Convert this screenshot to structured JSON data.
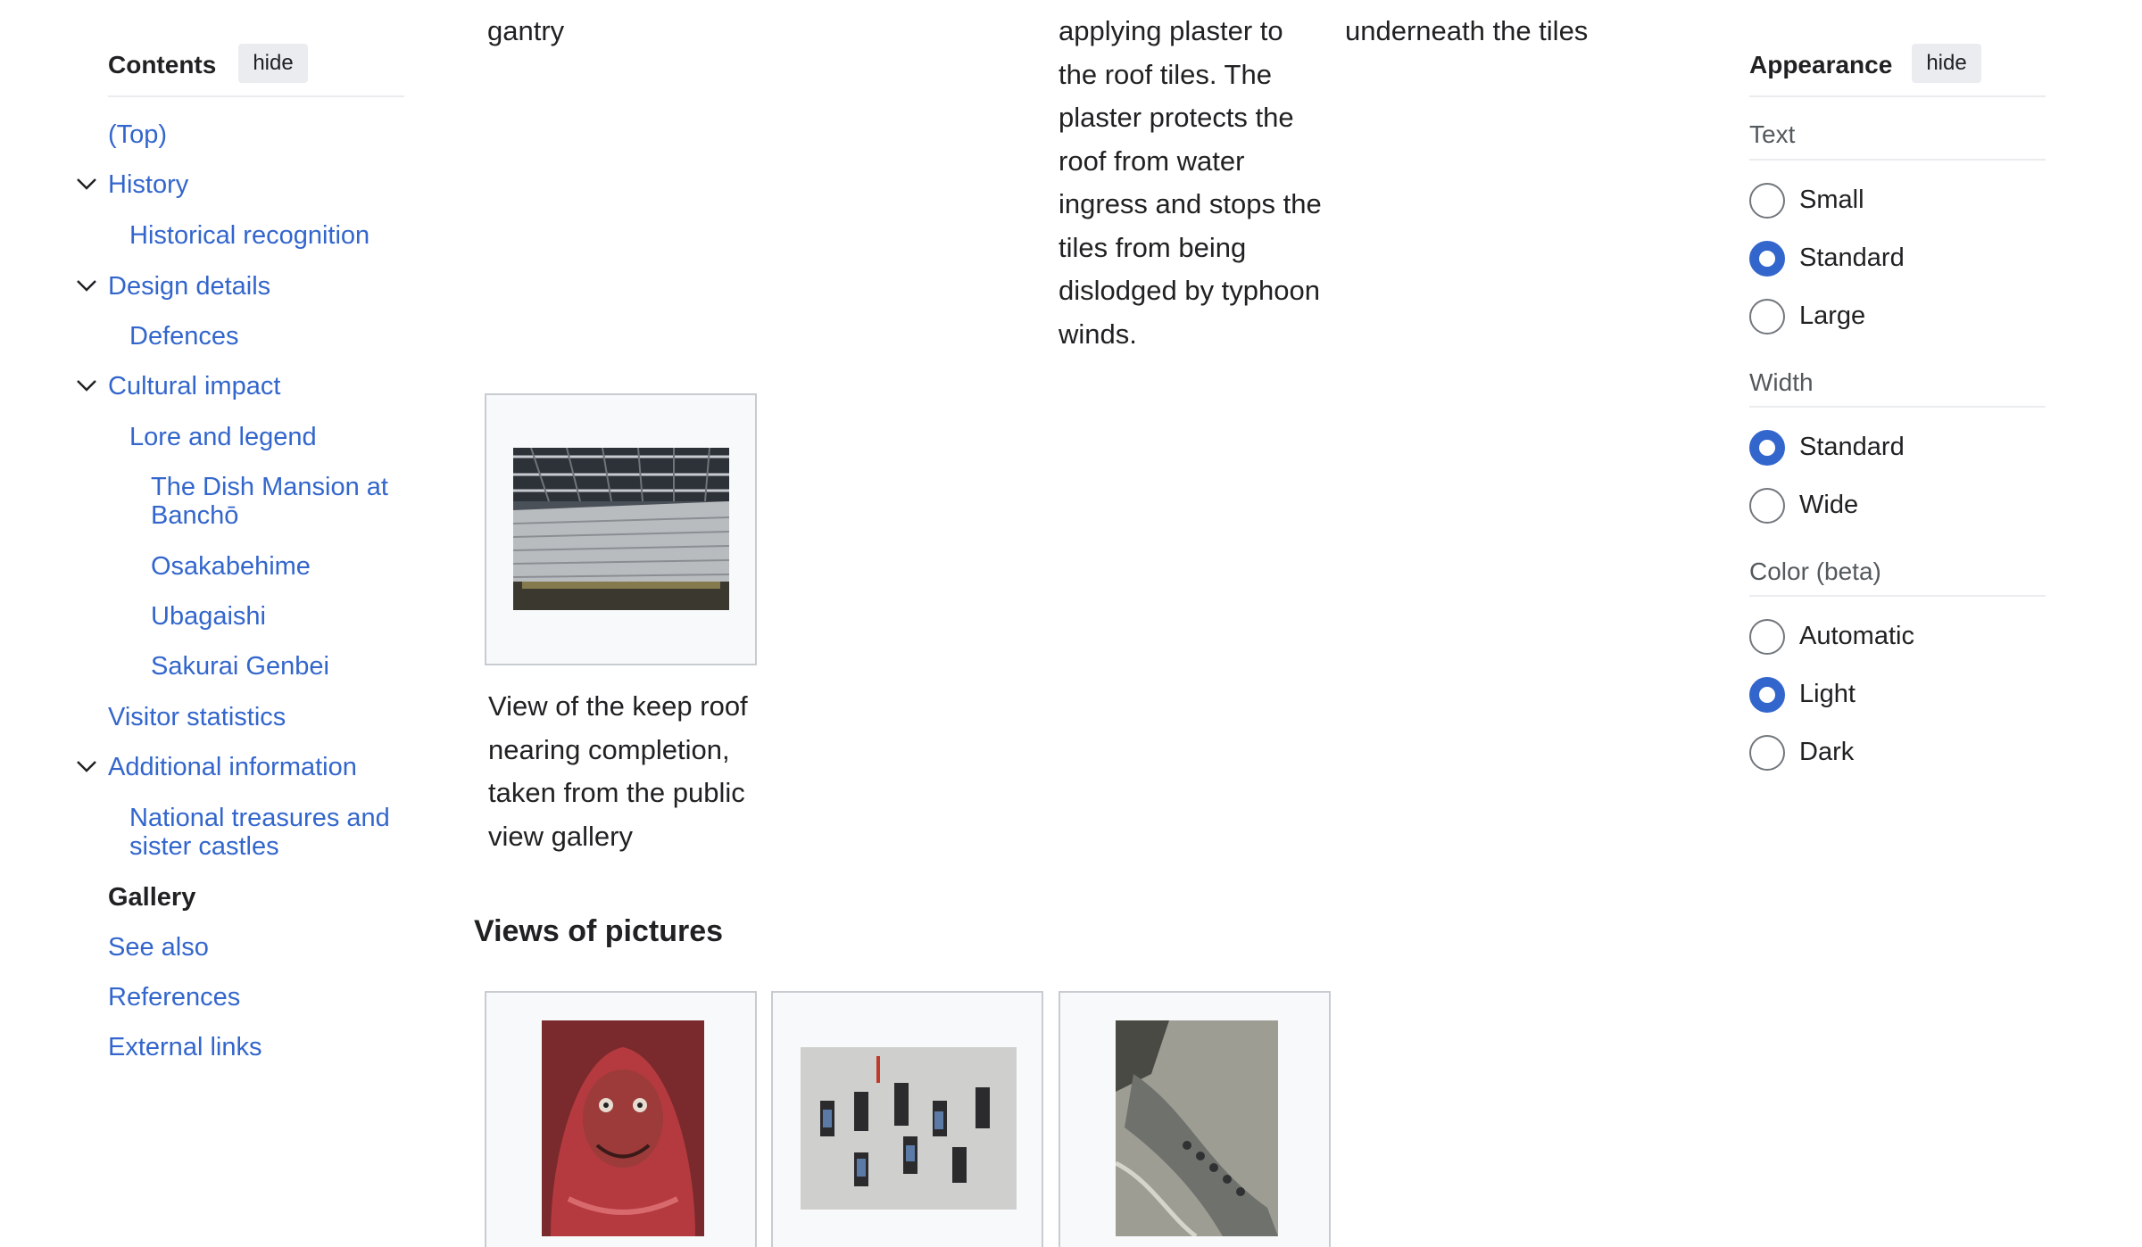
{
  "toc": {
    "title": "Contents",
    "hide_label": "hide",
    "items": [
      {
        "label": "(Top)"
      },
      {
        "label": "History"
      },
      {
        "label": "Historical recognition"
      },
      {
        "label": "Design details"
      },
      {
        "label": "Defences"
      },
      {
        "label": "Cultural impact"
      },
      {
        "label": "Lore and legend"
      },
      {
        "label": "The Dish Mansion at Banchō"
      },
      {
        "label": "Osakabehime"
      },
      {
        "label": "Ubagaishi"
      },
      {
        "label": "Sakurai Genbei"
      },
      {
        "label": "Visitor statistics"
      },
      {
        "label": "Additional information"
      },
      {
        "label": "National treasures and sister castles"
      },
      {
        "label": "Gallery"
      },
      {
        "label": "See also"
      },
      {
        "label": "References"
      },
      {
        "label": "External links"
      }
    ]
  },
  "main": {
    "col1_line": "gantry",
    "col2_lines": [
      "applying plaster to",
      "the roof tiles. The",
      "plaster protects the",
      "roof from water",
      "ingress and stops the",
      "tiles from being",
      "dislodged by typhoon",
      "winds."
    ],
    "col3_line": "underneath the tiles",
    "caption_lines": [
      "View of the keep roof",
      "nearing completion,",
      "taken from the public",
      "view gallery"
    ],
    "section_heading": "Views of pictures"
  },
  "appearance": {
    "title": "Appearance",
    "hide_label": "hide",
    "text_group": {
      "label": "Text",
      "options": [
        "Small",
        "Standard",
        "Large"
      ],
      "selected": "Standard"
    },
    "width_group": {
      "label": "Width",
      "options": [
        "Standard",
        "Wide"
      ],
      "selected": "Standard"
    },
    "color_group": {
      "label": "Color (beta)",
      "options": [
        "Automatic",
        "Light",
        "Dark"
      ],
      "selected": "Light"
    },
    "accent_color": "#3366cc"
  },
  "icons": {
    "chevron": "chevron-down-icon"
  }
}
